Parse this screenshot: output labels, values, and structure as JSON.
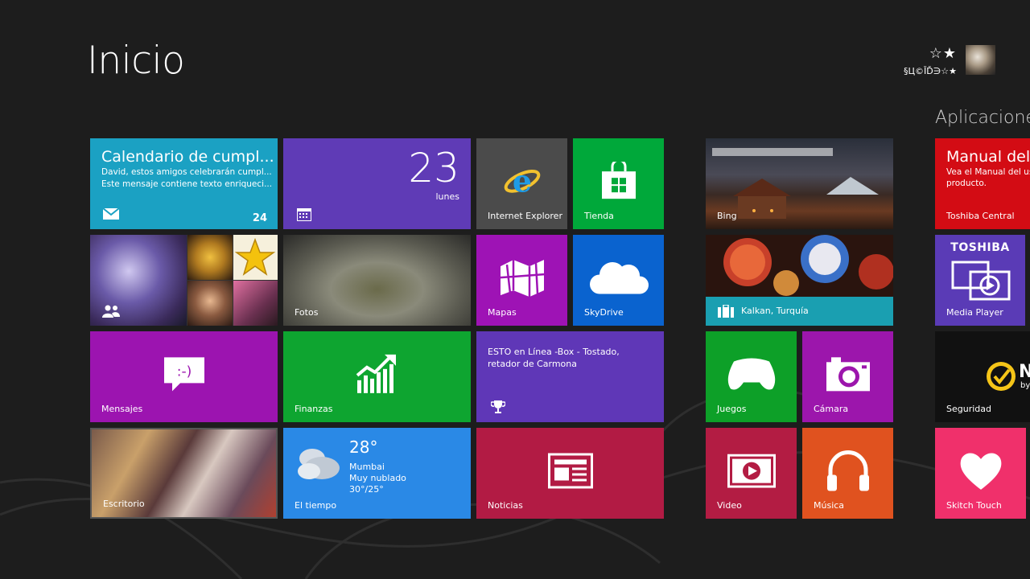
{
  "header": {
    "title": "Inicio"
  },
  "user": {
    "stars": "☆★",
    "name": "§Ц©ĪĎ∋☆★"
  },
  "groups": {
    "apps_title": "Aplicacione"
  },
  "tiles": {
    "calendar": {
      "title": "Calendario de cumpl...",
      "line1": "David, estos amigos celebrarán cumpl...",
      "line2": "Este mensaje contiene texto enriqueci...",
      "badge": "24",
      "color": "#1ba1c3"
    },
    "calendar_live": {
      "date": "23",
      "day": "lunes",
      "color": "#5f3bb6"
    },
    "ie": {
      "label": "Internet Explorer",
      "color": "#4b4b4b"
    },
    "tienda": {
      "label": "Tienda",
      "color": "#00a83a"
    },
    "people": {
      "icon": "people-icon"
    },
    "fotos": {
      "label": "Fotos"
    },
    "mapas": {
      "label": "Mapas",
      "color": "#9e13b5"
    },
    "skydrive": {
      "label": "SkyDrive",
      "color": "#0a63cf"
    },
    "mensajes": {
      "label": "Mensajes",
      "color": "#9c14b0"
    },
    "finanzas": {
      "label": "Finanzas",
      "color": "#0ea530"
    },
    "xbox": {
      "text": "ESTO en Línea -Box - Tostado, retador de Carmona",
      "color": "#5f37b7"
    },
    "escritorio": {
      "label": "Escritorio"
    },
    "tiempo": {
      "label": "El tiempo",
      "temp": "28°",
      "city": "Mumbai",
      "condition": "Muy nublado",
      "range": "30°/25°",
      "color": "#2a89e6"
    },
    "noticias": {
      "label": "Noticias",
      "color": "#b21b44"
    },
    "bing": {
      "label": "Bing"
    },
    "travel": {
      "label": "Kalkan, Turquía",
      "color": "#1a9fb1"
    },
    "juegos": {
      "label": "Juegos",
      "color": "#0da028"
    },
    "camara": {
      "label": "Cámara",
      "color": "#9c16ac"
    },
    "video": {
      "label": "Video",
      "color": "#b31c43"
    },
    "musica": {
      "label": "Música",
      "color": "#e0521f"
    },
    "manual": {
      "title": "Manual del u",
      "line1": "Vea el Manual del us",
      "line2": "producto.",
      "label": "Toshiba Central",
      "color": "#d30c14"
    },
    "media": {
      "brand": "TOSHIBA",
      "label": "Media Player",
      "color": "#5a3bb6"
    },
    "seguridad": {
      "label": "Seguridad",
      "brand": "N",
      "brand_sub": "by"
    },
    "skitch": {
      "label": "Skitch Touch",
      "color": "#f0306b"
    }
  }
}
